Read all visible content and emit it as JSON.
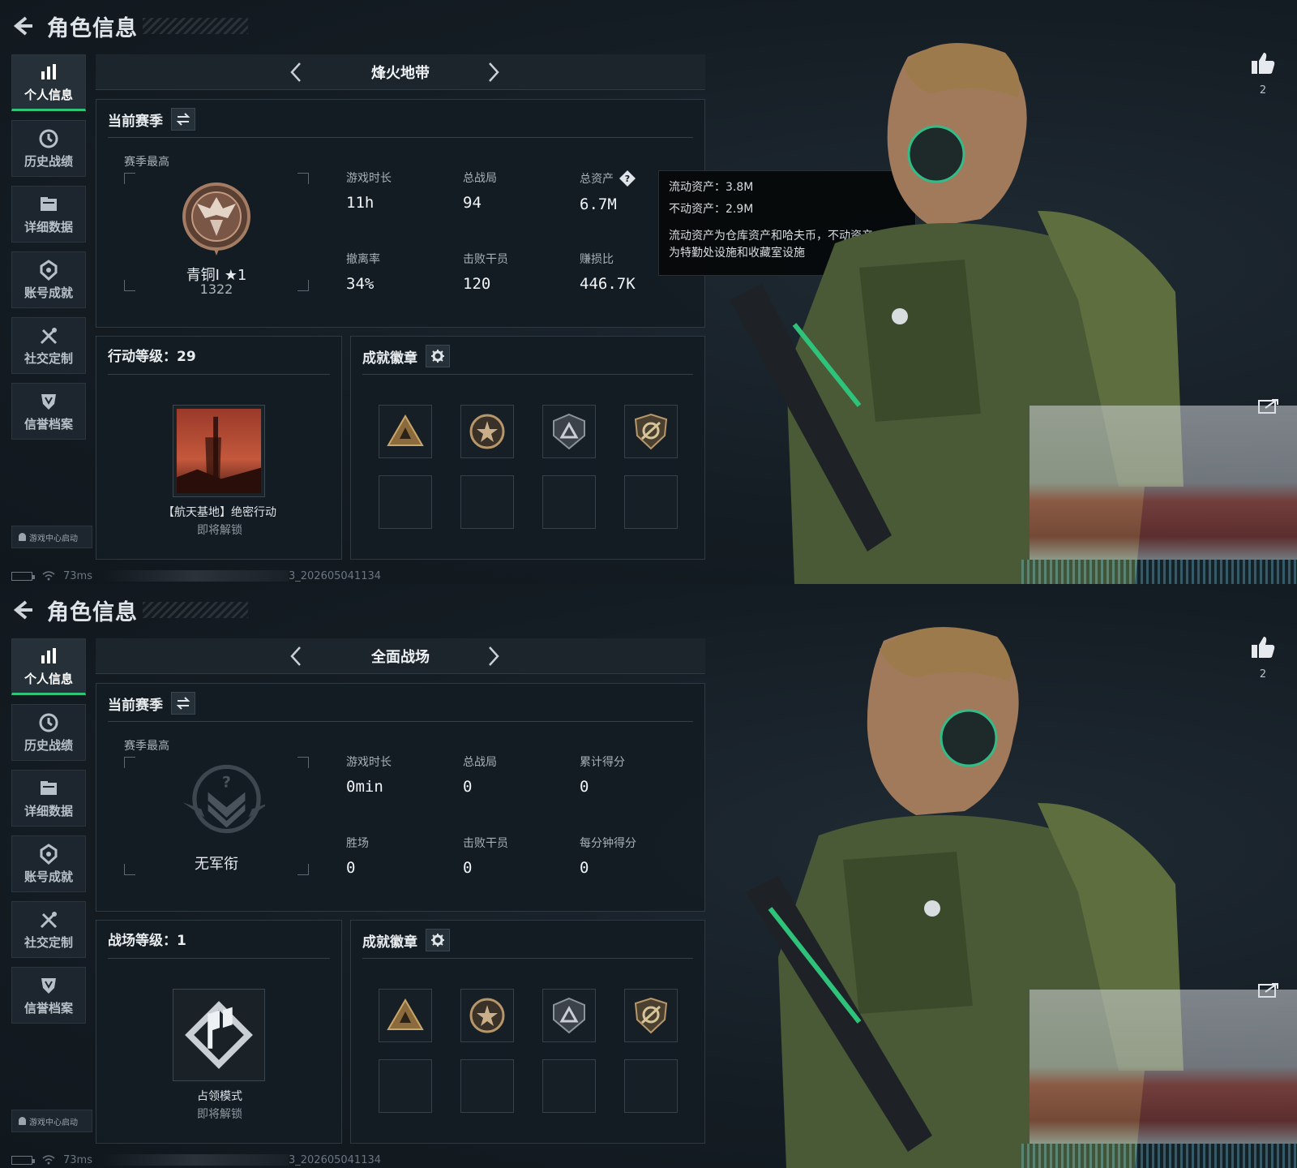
{
  "screens": [
    {
      "header": {
        "title": "角色信息"
      },
      "sidebar": {
        "items": [
          {
            "label": "个人信息",
            "icon": "bar-chart-icon",
            "active": true
          },
          {
            "label": "历史战绩",
            "icon": "clock-icon"
          },
          {
            "label": "详细数据",
            "icon": "folder-icon"
          },
          {
            "label": "账号成就",
            "icon": "achievement-icon"
          },
          {
            "label": "社交定制",
            "icon": "tools-icon"
          },
          {
            "label": "信誉档案",
            "icon": "shield-icon"
          }
        ],
        "launch_label": "游戏中心启动"
      },
      "status": {
        "ping": "73ms",
        "build": "3_202605041134"
      },
      "mode": {
        "title": "烽火地带"
      },
      "season": {
        "title": "当前赛季",
        "best_label": "赛季最高",
        "rank_name": "青铜I ★1",
        "rank_score": "1322",
        "stats": [
          {
            "label": "游戏时长",
            "value": "11h"
          },
          {
            "label": "总战局",
            "value": "94"
          },
          {
            "label": "总资产",
            "value": "6.7M",
            "help": true
          },
          {
            "label": "撤离率",
            "value": "34%"
          },
          {
            "label": "击败干员",
            "value": "120"
          },
          {
            "label": "赚损比",
            "value": "446.7K"
          }
        ]
      },
      "tooltip": {
        "line1": "流动资产：3.8M",
        "line2": "不动资产：2.9M",
        "note1": "流动资产为仓库资产和哈夫币，不动资产",
        "note2": "为特勤处设施和收藏室设施"
      },
      "level": {
        "title": "行动等级：29",
        "event_name": "【航天基地】绝密行动",
        "event_sub": "即将解锁"
      },
      "badges": {
        "title": "成就徽章"
      },
      "likes": {
        "count": "2"
      }
    },
    {
      "header": {
        "title": "角色信息"
      },
      "sidebar": {
        "items": [
          {
            "label": "个人信息",
            "icon": "bar-chart-icon",
            "active": true
          },
          {
            "label": "历史战绩",
            "icon": "clock-icon"
          },
          {
            "label": "详细数据",
            "icon": "folder-icon"
          },
          {
            "label": "账号成就",
            "icon": "achievement-icon"
          },
          {
            "label": "社交定制",
            "icon": "tools-icon"
          },
          {
            "label": "信誉档案",
            "icon": "shield-icon"
          }
        ],
        "launch_label": "游戏中心启动"
      },
      "status": {
        "ping": "73ms",
        "build": "3_202605041134"
      },
      "mode": {
        "title": "全面战场"
      },
      "season": {
        "title": "当前赛季",
        "best_label": "赛季最高",
        "rank_name": "无军衔",
        "rank_score": "",
        "stats": [
          {
            "label": "游戏时长",
            "value": "0min"
          },
          {
            "label": "总战局",
            "value": "0"
          },
          {
            "label": "累计得分",
            "value": "0"
          },
          {
            "label": "胜场",
            "value": "0"
          },
          {
            "label": "击败干员",
            "value": "0"
          },
          {
            "label": "每分钟得分",
            "value": "0"
          }
        ]
      },
      "level": {
        "title": "战场等级：1",
        "event_name": "占领模式",
        "event_sub": "即将解锁"
      },
      "badges": {
        "title": "成就徽章"
      },
      "likes": {
        "count": "2"
      }
    }
  ],
  "colors": {
    "accent": "#33c27a",
    "panel": "#141c23",
    "text": "#e6eaee",
    "bronze": "#8a6450"
  }
}
